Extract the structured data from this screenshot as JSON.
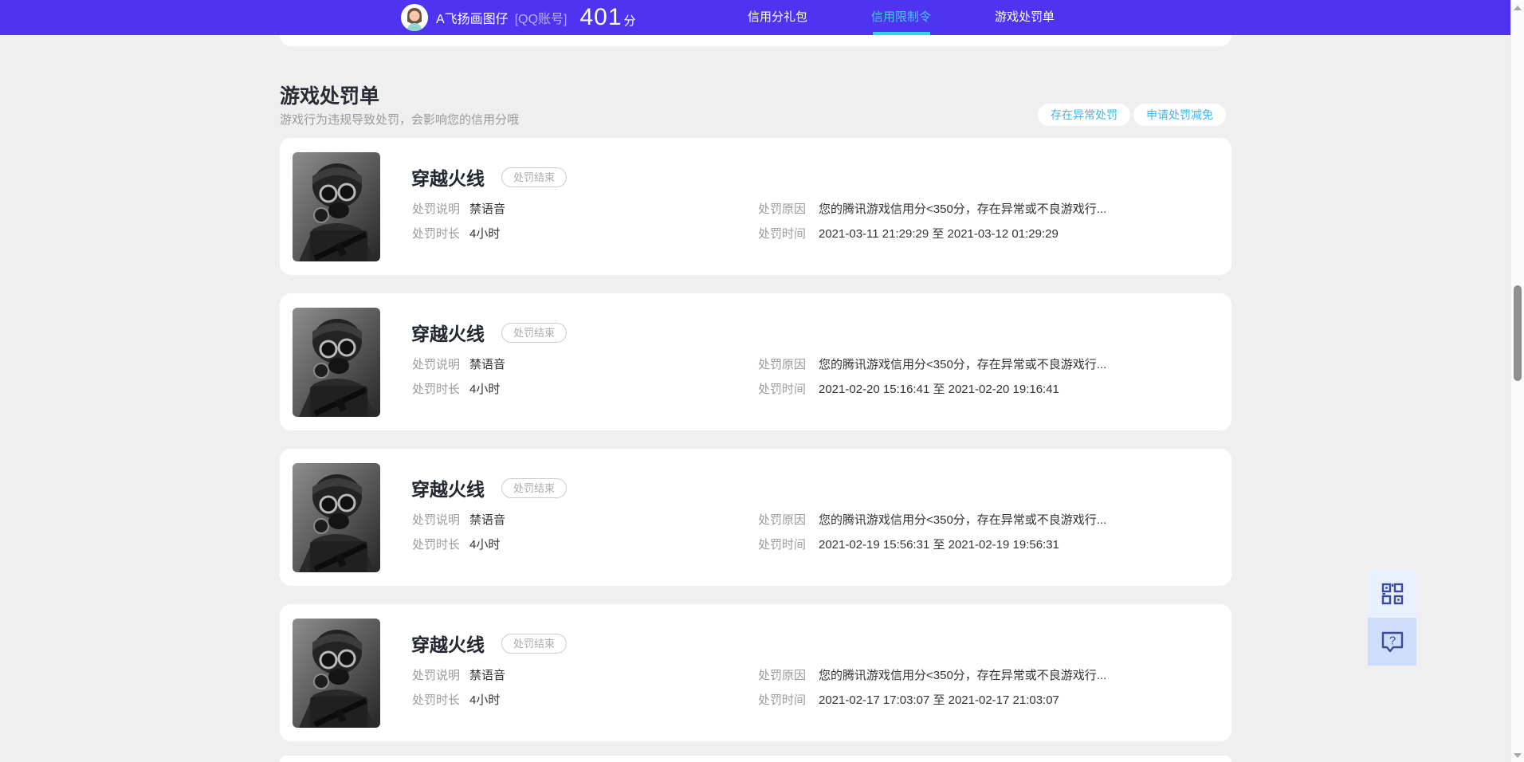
{
  "header": {
    "username": "A飞扬画图仔",
    "account_label": "[QQ账号]",
    "score": "401",
    "score_unit": "分",
    "nav": [
      {
        "label": "信用分礼包"
      },
      {
        "label": "信用限制令"
      },
      {
        "label": "游戏处罚单"
      }
    ],
    "active_nav": "信用限制令"
  },
  "page": {
    "title": "游戏处罚单",
    "subtitle": "游戏行为违规导致处罚，会影响您的信用分哦",
    "actions": [
      {
        "label": "存在异常处罚"
      },
      {
        "label": "申请处罚减免"
      }
    ]
  },
  "cards": [
    {
      "game_title": "穿越火线",
      "status_badge": "处罚结束",
      "left_fields": [
        {
          "label": "处罚说明",
          "value": "禁语音"
        },
        {
          "label": "处罚时长",
          "value": "4小时"
        }
      ],
      "right_fields": [
        {
          "label": "处罚原因",
          "value": "您的腾讯游戏信用分<350分，存在异常或不良游戏行..."
        },
        {
          "label": "处罚时间",
          "value": "2021-03-11 21:29:29 至 2021-03-12 01:29:29"
        }
      ]
    },
    {
      "game_title": "穿越火线",
      "status_badge": "处罚结束",
      "left_fields": [
        {
          "label": "处罚说明",
          "value": "禁语音"
        },
        {
          "label": "处罚时长",
          "value": "4小时"
        }
      ],
      "right_fields": [
        {
          "label": "处罚原因",
          "value": "您的腾讯游戏信用分<350分，存在异常或不良游戏行..."
        },
        {
          "label": "处罚时间",
          "value": "2021-02-20 15:16:41 至 2021-02-20 19:16:41"
        }
      ]
    },
    {
      "game_title": "穿越火线",
      "status_badge": "处罚结束",
      "left_fields": [
        {
          "label": "处罚说明",
          "value": "禁语音"
        },
        {
          "label": "处罚时长",
          "value": "4小时"
        }
      ],
      "right_fields": [
        {
          "label": "处罚原因",
          "value": "您的腾讯游戏信用分<350分，存在异常或不良游戏行..."
        },
        {
          "label": "处罚时间",
          "value": "2021-02-19 15:56:31 至 2021-02-19 19:56:31"
        }
      ]
    },
    {
      "game_title": "穿越火线",
      "status_badge": "处罚结束",
      "left_fields": [
        {
          "label": "处罚说明",
          "value": "禁语音"
        },
        {
          "label": "处罚时长",
          "value": "4小时"
        }
      ],
      "right_fields": [
        {
          "label": "处罚原因",
          "value": "您的腾讯游戏信用分<350分，存在异常或不良游戏行..."
        },
        {
          "label": "处罚时间",
          "value": "2021-02-17 17:03:07 至 2021-02-17 21:03:07"
        }
      ]
    }
  ],
  "floating_buttons": [
    {
      "icon": "qr-code-icon"
    },
    {
      "icon": "help-question-icon"
    }
  ],
  "colors": {
    "header_bg": "#4e33f1",
    "nav_active_text": "#49c9f8",
    "nav_active_underline": "#2bd7f0",
    "page_bg": "#efefef",
    "card_bg": "#ffffff",
    "action_button_text": "#40b5f0",
    "badge_border": "#cccccc",
    "label_gray": "#9b9b9b",
    "value_dark": "#333333",
    "float_qr_bg": "#e8effd",
    "float_help_bg": "#cdddfa",
    "float_icon": "#3a4b9e"
  }
}
